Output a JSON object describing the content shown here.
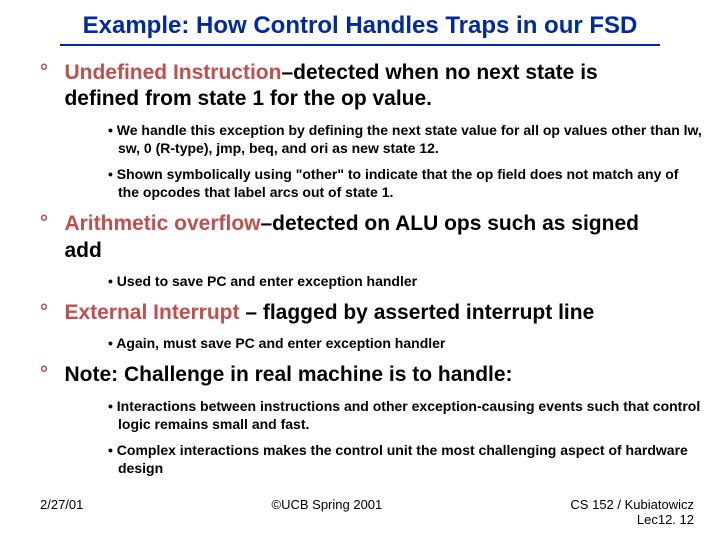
{
  "title": "Example: How Control Handles Traps in our FSD",
  "items": [
    {
      "headRed": "Undefined Instruction",
      "headRest": "–detected when no next state is defined from state 1 for the op value.",
      "subs": [
        "We handle this exception by defining the next state value for all op values other than lw, sw, 0 (R-type), jmp, beq, and ori as new state 12.",
        "Shown symbolically using \"other\" to indicate that the op field does not match any of the opcodes that label arcs out of state 1."
      ]
    },
    {
      "headRed": "Arithmetic overflow",
      "headRest": "–detected on ALU ops such as signed add",
      "subs": [
        "Used to save PC and enter exception handler"
      ]
    },
    {
      "headRed": "External Interrupt",
      "headRest": " – flagged by asserted interrupt line",
      "subs": [
        "Again, must save PC and enter exception handler"
      ]
    },
    {
      "headRed": "",
      "headRest": "Note: Challenge in real machine is to handle:",
      "subs": [
        "Interactions between instructions and other exception-causing events such that control logic remains small and fast.",
        "Complex interactions makes the control unit the most challenging aspect of hardware design"
      ]
    }
  ],
  "footer": {
    "left": "2/27/01",
    "mid": "©UCB Spring 2001",
    "right1": "CS 152 / Kubiatowicz",
    "right2": "Lec12. 12"
  }
}
